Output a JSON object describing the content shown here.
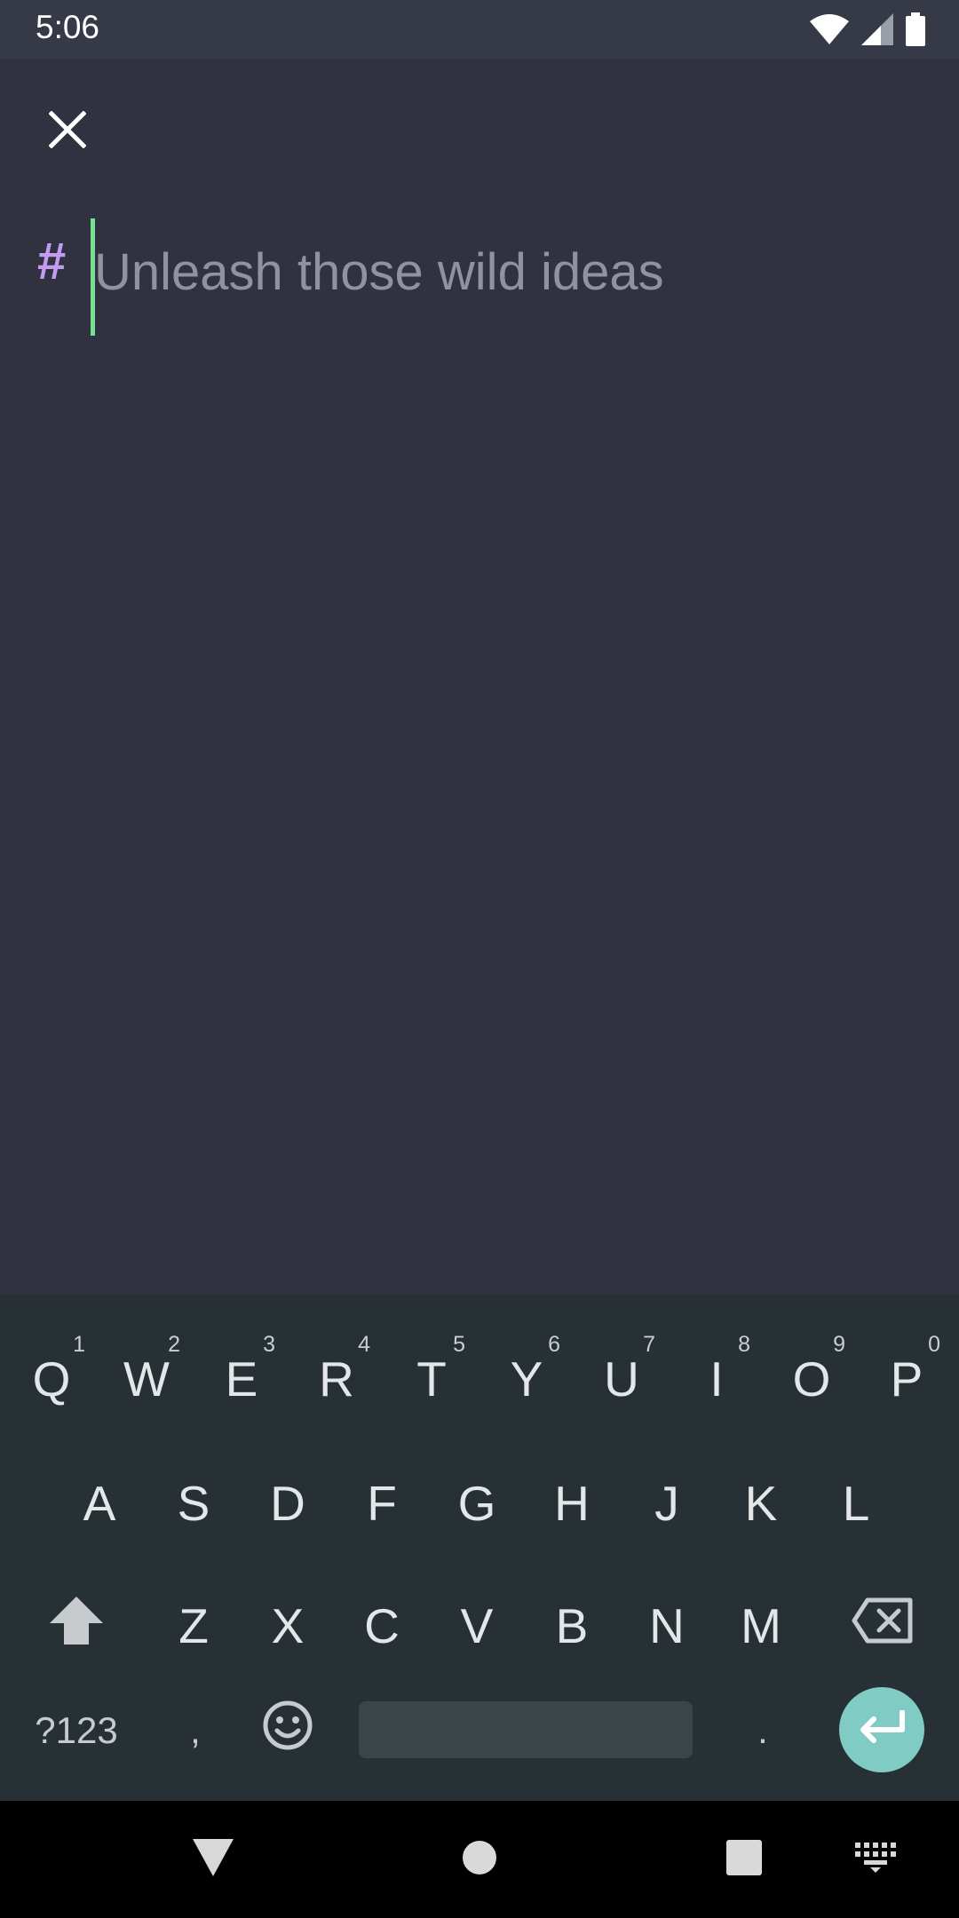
{
  "status_bar": {
    "time": "5:06",
    "icons": [
      "wifi-icon",
      "signal-icon",
      "battery-icon"
    ]
  },
  "editor": {
    "close_icon": "close-icon",
    "heading_marker": "#",
    "placeholder": "Unleash those wild ideas",
    "value": ""
  },
  "keyboard": {
    "row1": [
      {
        "label": "Q",
        "hint": "1"
      },
      {
        "label": "W",
        "hint": "2"
      },
      {
        "label": "E",
        "hint": "3"
      },
      {
        "label": "R",
        "hint": "4"
      },
      {
        "label": "T",
        "hint": "5"
      },
      {
        "label": "Y",
        "hint": "6"
      },
      {
        "label": "U",
        "hint": "7"
      },
      {
        "label": "I",
        "hint": "8"
      },
      {
        "label": "O",
        "hint": "9"
      },
      {
        "label": "P",
        "hint": "0"
      }
    ],
    "row2": [
      "A",
      "S",
      "D",
      "F",
      "G",
      "H",
      "J",
      "K",
      "L"
    ],
    "row3": [
      "Z",
      "X",
      "C",
      "V",
      "B",
      "N",
      "M"
    ],
    "symbols_label": "?123",
    "comma_label": ",",
    "period_label": ".",
    "shift_icon": "shift-icon",
    "backspace_icon": "backspace-icon",
    "emoji_icon": "emoji-icon",
    "enter_icon": "enter-icon"
  },
  "nav_bar": {
    "icons": [
      "back-icon",
      "home-icon",
      "recents-icon",
      "keyboard-switch-icon"
    ]
  },
  "colors": {
    "background": "#30333f",
    "accent_hash": "#c39bf3",
    "cursor": "#78e08f",
    "keyboard_bg": "#263035",
    "enter_key": "#80cbc4"
  }
}
